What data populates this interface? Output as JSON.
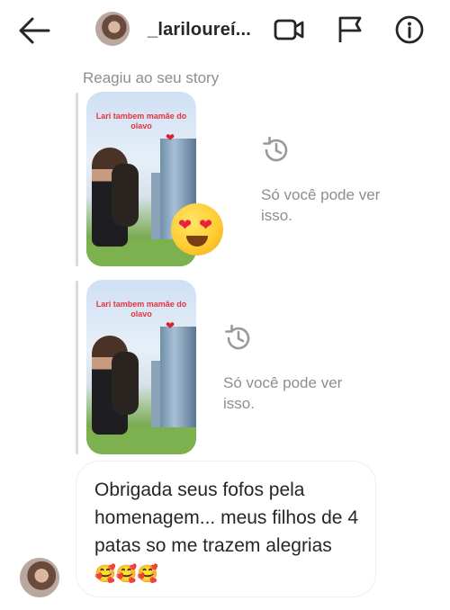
{
  "header": {
    "username": "_lariloureí...",
    "icons": {
      "back": "back-arrow-icon",
      "video": "video-call-icon",
      "flag": "flag-icon",
      "info": "info-icon"
    }
  },
  "thread": {
    "reply_label": "Reagiu ao seu story",
    "stories": [
      {
        "caption": "Lari tambem mamãe do olavo",
        "heart": "❤",
        "expired_text": "Só você pode ver isso."
      },
      {
        "caption": "Lari tambem mamãe do olavo",
        "heart": "❤",
        "expired_text": "Só você pode ver isso."
      }
    ],
    "reaction_emoji": "heart-eyes-emoji",
    "message": {
      "text": "Obrigada seus fofos pela homenagem... meus filhos de 4 patas so me trazem alegrias",
      "emojis": "🥰🥰🥰"
    }
  },
  "colors": {
    "text": "#262626",
    "muted": "#8e8e8e",
    "caption_red": "#e8323e"
  }
}
